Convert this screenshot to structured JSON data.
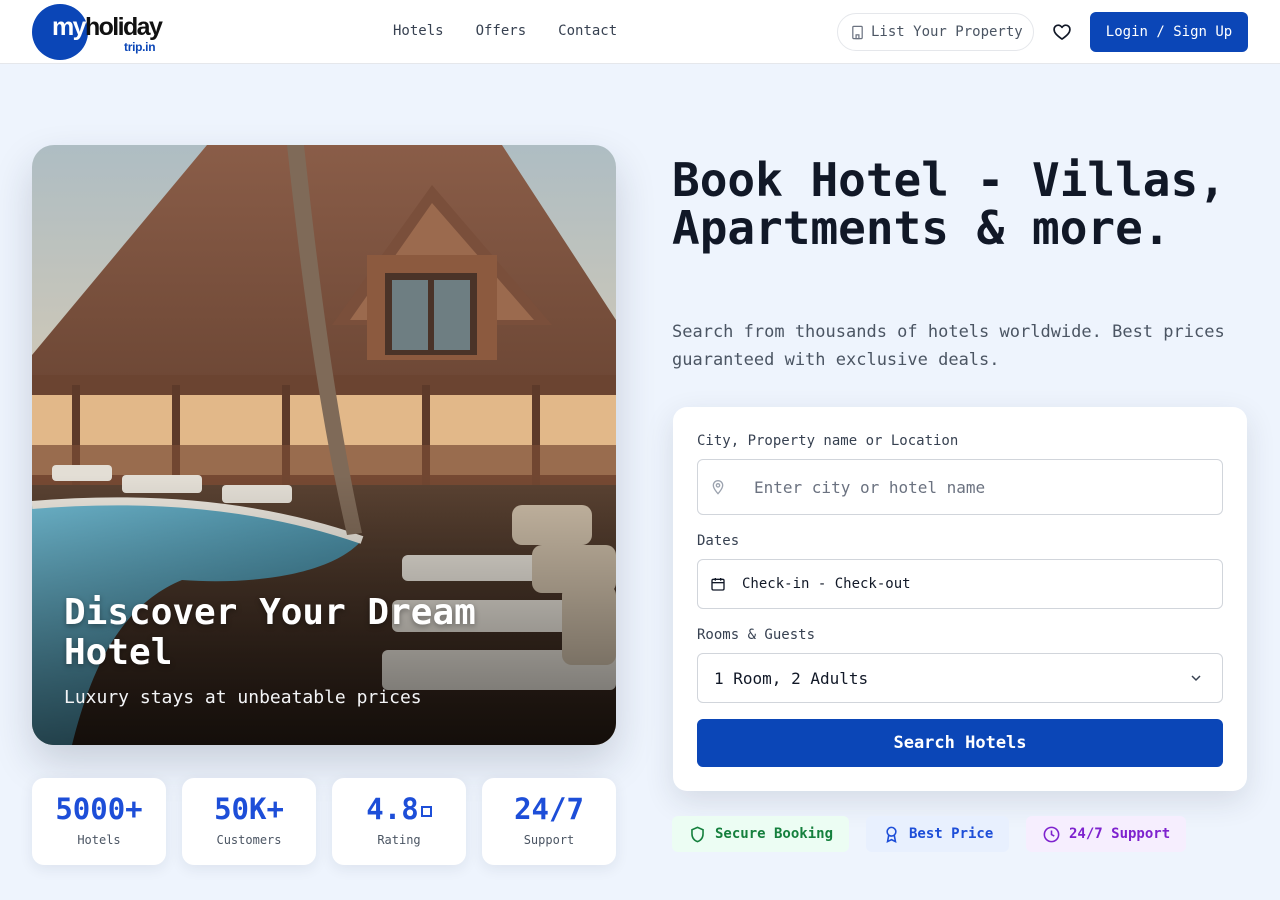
{
  "header": {
    "logo": {
      "word_part1": "my",
      "word_part2": "holiday",
      "sub": "trip.in"
    },
    "nav": [
      "Hotels",
      "Offers",
      "Contact"
    ],
    "list_property": "List Your Property",
    "login": "Login / Sign Up"
  },
  "hero": {
    "title": "Discover Your Dream Hotel",
    "subtitle": "Luxury stays at unbeatable prices"
  },
  "stats": [
    {
      "value": "5000+",
      "label": "Hotels"
    },
    {
      "value": "50K+",
      "label": "Customers"
    },
    {
      "value": "4.8",
      "label": "Rating"
    },
    {
      "value": "24/7",
      "label": "Support"
    }
  ],
  "main": {
    "headline": "Book Hotel - Villas, Apartments & more.",
    "subline": "Search from thousands of hotels worldwide. Best prices guaranteed with exclusive deals."
  },
  "search": {
    "location_label": "City, Property name or Location",
    "location_placeholder": "Enter city or hotel name",
    "dates_label": "Dates",
    "dates_value": "Check-in - Check-out",
    "rooms_label": "Rooms & Guests",
    "rooms_value": "1 Room, 2 Adults",
    "button": "Search Hotels"
  },
  "badges": [
    {
      "label": "Secure Booking",
      "icon": "shield-icon",
      "color": "#15803d",
      "bg": "#ecfdf3"
    },
    {
      "label": "Best Price",
      "icon": "award-icon",
      "color": "#1d4ed8",
      "bg": "#e8f0fe"
    },
    {
      "label": "24/7 Support",
      "icon": "clock-icon",
      "color": "#7e22ce",
      "bg": "#f6eefe"
    }
  ],
  "colors": {
    "brand": "#0b46b7",
    "accent": "#1d4ed8",
    "background": "#eef4fd"
  }
}
